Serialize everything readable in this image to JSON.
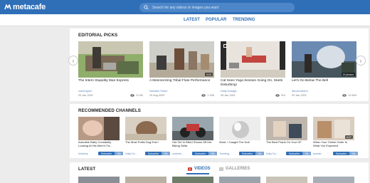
{
  "brand": {
    "name": "metacafe",
    "accent": "#2f6fb8"
  },
  "search": {
    "placeholder": "Search for any videos or images you want"
  },
  "nav": {
    "latest": "LATEST",
    "popular": "POPULAR",
    "trending": "TRENDING"
  },
  "editorial": {
    "title": "EDITORIAL PICKS",
    "cards": [
      {
        "title": "The Intern Stupidity Man Express",
        "author": "curtemgum",
        "date": "20 Jan 2021",
        "views": "6 150",
        "duration": ""
      },
      {
        "title": "A Mesmerizing Tribal Flute Performance",
        "author": "Nandani Sruhe",
        "date": "19 Aug 2020",
        "views": "1 005",
        "duration": "0:00"
      },
      {
        "title": "Cat Sees Yoga Session Going On, Starts Disturbing!",
        "author": "Daily Dosage",
        "date": "26 Jan 2021",
        "views": "919",
        "duration": ""
      },
      {
        "title": "Let's Go Below The Bell",
        "author": "danzunwhere",
        "date": "20 Jan 2021",
        "views": "10 893",
        "duration": "20 photos"
      }
    ]
  },
  "channels": {
    "title": "RECOMMENDED CHANNELS",
    "subscribe_label": "Subscribe",
    "cards": [
      {
        "title": "Adorable Baby Constantly Looking At His Mom's Fa...",
        "channel": "kimberly",
        "count": "15k",
        "duration": ""
      },
      {
        "title": "The Most Polite Dog Ever!",
        "channel": "Daily Do...",
        "count": "15k",
        "duration": ""
      },
      {
        "title": "Hot Girl In Bikini Shows Off Her Biking Skills",
        "channel": "motorsk...",
        "count": "15k",
        "duration": ""
      },
      {
        "title": "Woof, I Caught The Doll",
        "channel": "Trending...",
        "count": "15k",
        "duration": ""
      },
      {
        "title": "The Best Prank On Your GF",
        "channel": "Daily Do...",
        "count": "15k",
        "duration": ""
      },
      {
        "title": "When Your Online Order Is What You Expected",
        "channel": "powder",
        "count": "15k",
        "duration": "0:27"
      }
    ]
  },
  "latest": {
    "title": "LATEST",
    "videos_tab": "VIDEOS",
    "galleries_tab": "GALLERIES"
  }
}
